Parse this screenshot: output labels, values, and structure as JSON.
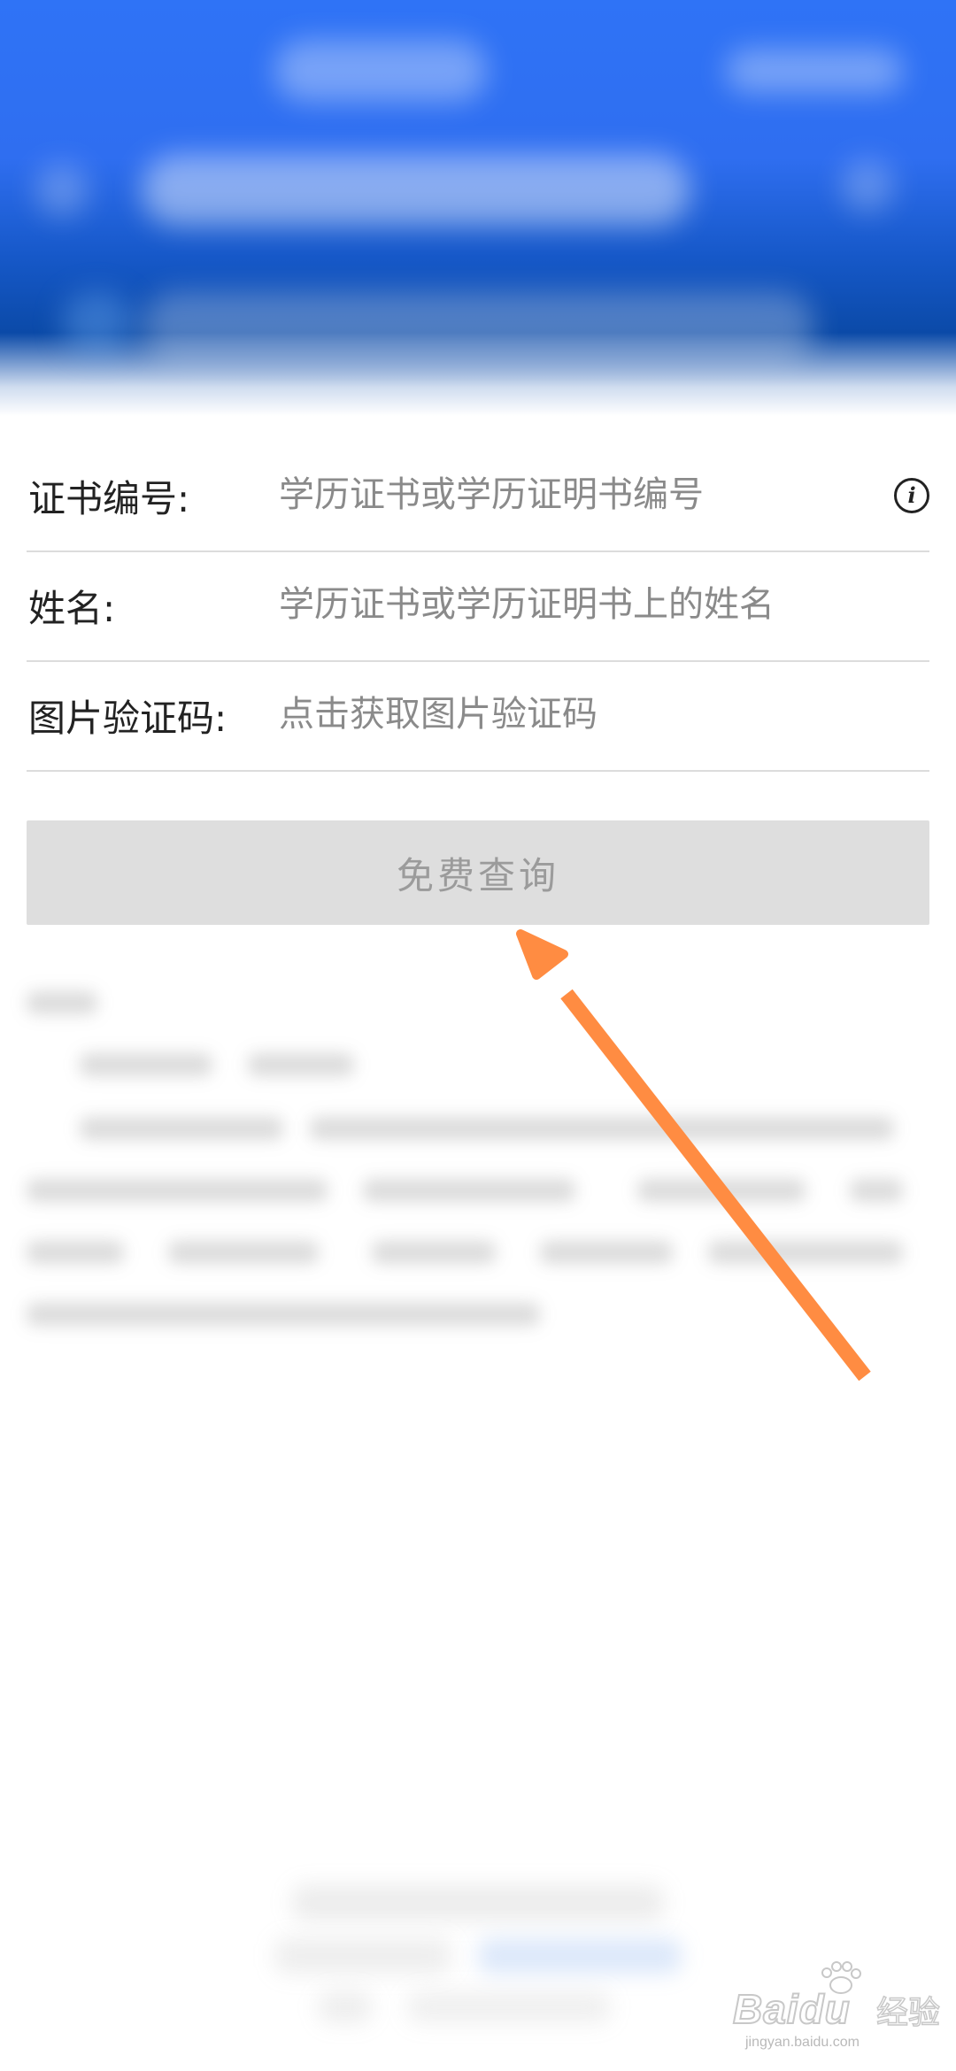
{
  "form": {
    "rows": [
      {
        "label": "证书编号:",
        "placeholder": "学历证书或学历证明书编号"
      },
      {
        "label": "姓名:",
        "placeholder": "学历证书或学历证明书上的姓名"
      },
      {
        "label": "图片验证码:",
        "placeholder": "点击获取图片验证码"
      }
    ],
    "info_icon": "i"
  },
  "query_button": {
    "label": "免费查询",
    "state": "disabled"
  },
  "annotation": {
    "arrow_color": "#FF8C42",
    "points_to": "query_button"
  },
  "header": {
    "primary_color": "#2F73F6",
    "dark_color": "#0B4AA8"
  },
  "watermark": {
    "brand": "Baidu",
    "cn": "经验",
    "url": "jingyan.baidu.com"
  }
}
